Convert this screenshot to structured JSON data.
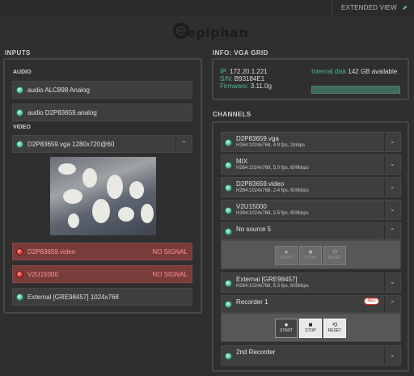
{
  "header": {
    "extended_view": "EXTENDED VIEW",
    "logo_text": "epiphan",
    "logo_tagline": "systems inc."
  },
  "inputs": {
    "title": "INPUTS",
    "audio_label": "AUDIO",
    "audio": [
      "audio ALC898 Analog",
      "audio D2P83659.analog"
    ],
    "video_label": "VIDEO",
    "selected_video": "D2P83659.vga 1280x720@60",
    "sources": [
      {
        "label": "D2P83659.video",
        "status": "NO SIGNAL",
        "state": "error"
      },
      {
        "label": "V2U15000",
        "status": "NO SIGNAL",
        "state": "error"
      },
      {
        "label": "External [GRE98457] 1024x768",
        "status": "",
        "state": "ok"
      }
    ]
  },
  "info": {
    "title": "INFO: VGA GRID",
    "ip_label": "IP:",
    "ip": "172.20.1.221",
    "sn_label": "S/N:",
    "sn": "B93184E1",
    "fw_label": "Firmware:",
    "fw": "3.11.0g",
    "disk_label": "Internal disk",
    "disk_value": "142 GB available",
    "disk_used_fraction": 0.0
  },
  "channels": {
    "title": "CHANNELS",
    "items": [
      {
        "name": "D2P83659.vga",
        "detail": "H264:1024x768, 4.9 fps, 2mbps"
      },
      {
        "name": "MIX",
        "detail": "H264:1024x768, 5.0 fps, 600kbps"
      },
      {
        "name": "D2P83659.video",
        "detail": "H264:1024x768, 2.4 fps, 600kbps"
      },
      {
        "name": "V2U15000",
        "detail": "H264:1024x768, 2.5 fps, 600kbps"
      },
      {
        "name": "No source 5",
        "detail": ""
      },
      {
        "name": "External [GRE98457]",
        "detail": "H264:1024x768, 5.3 fps, 600kbps"
      },
      {
        "name": "Recorder 1",
        "detail": "",
        "badge": "REC"
      },
      {
        "name": "2nd Recorder",
        "detail": ""
      }
    ],
    "controls": {
      "start": "START",
      "stop": "STOP",
      "reset": "RESET"
    }
  },
  "colors": {
    "accent": "#4fb79c",
    "error": "#e03a3a",
    "background": "#2f2f2f"
  },
  "icons": {
    "external_link": "external-link-icon",
    "chevron_down": "chevron-down-icon",
    "chevron_up": "chevron-up-icon"
  }
}
